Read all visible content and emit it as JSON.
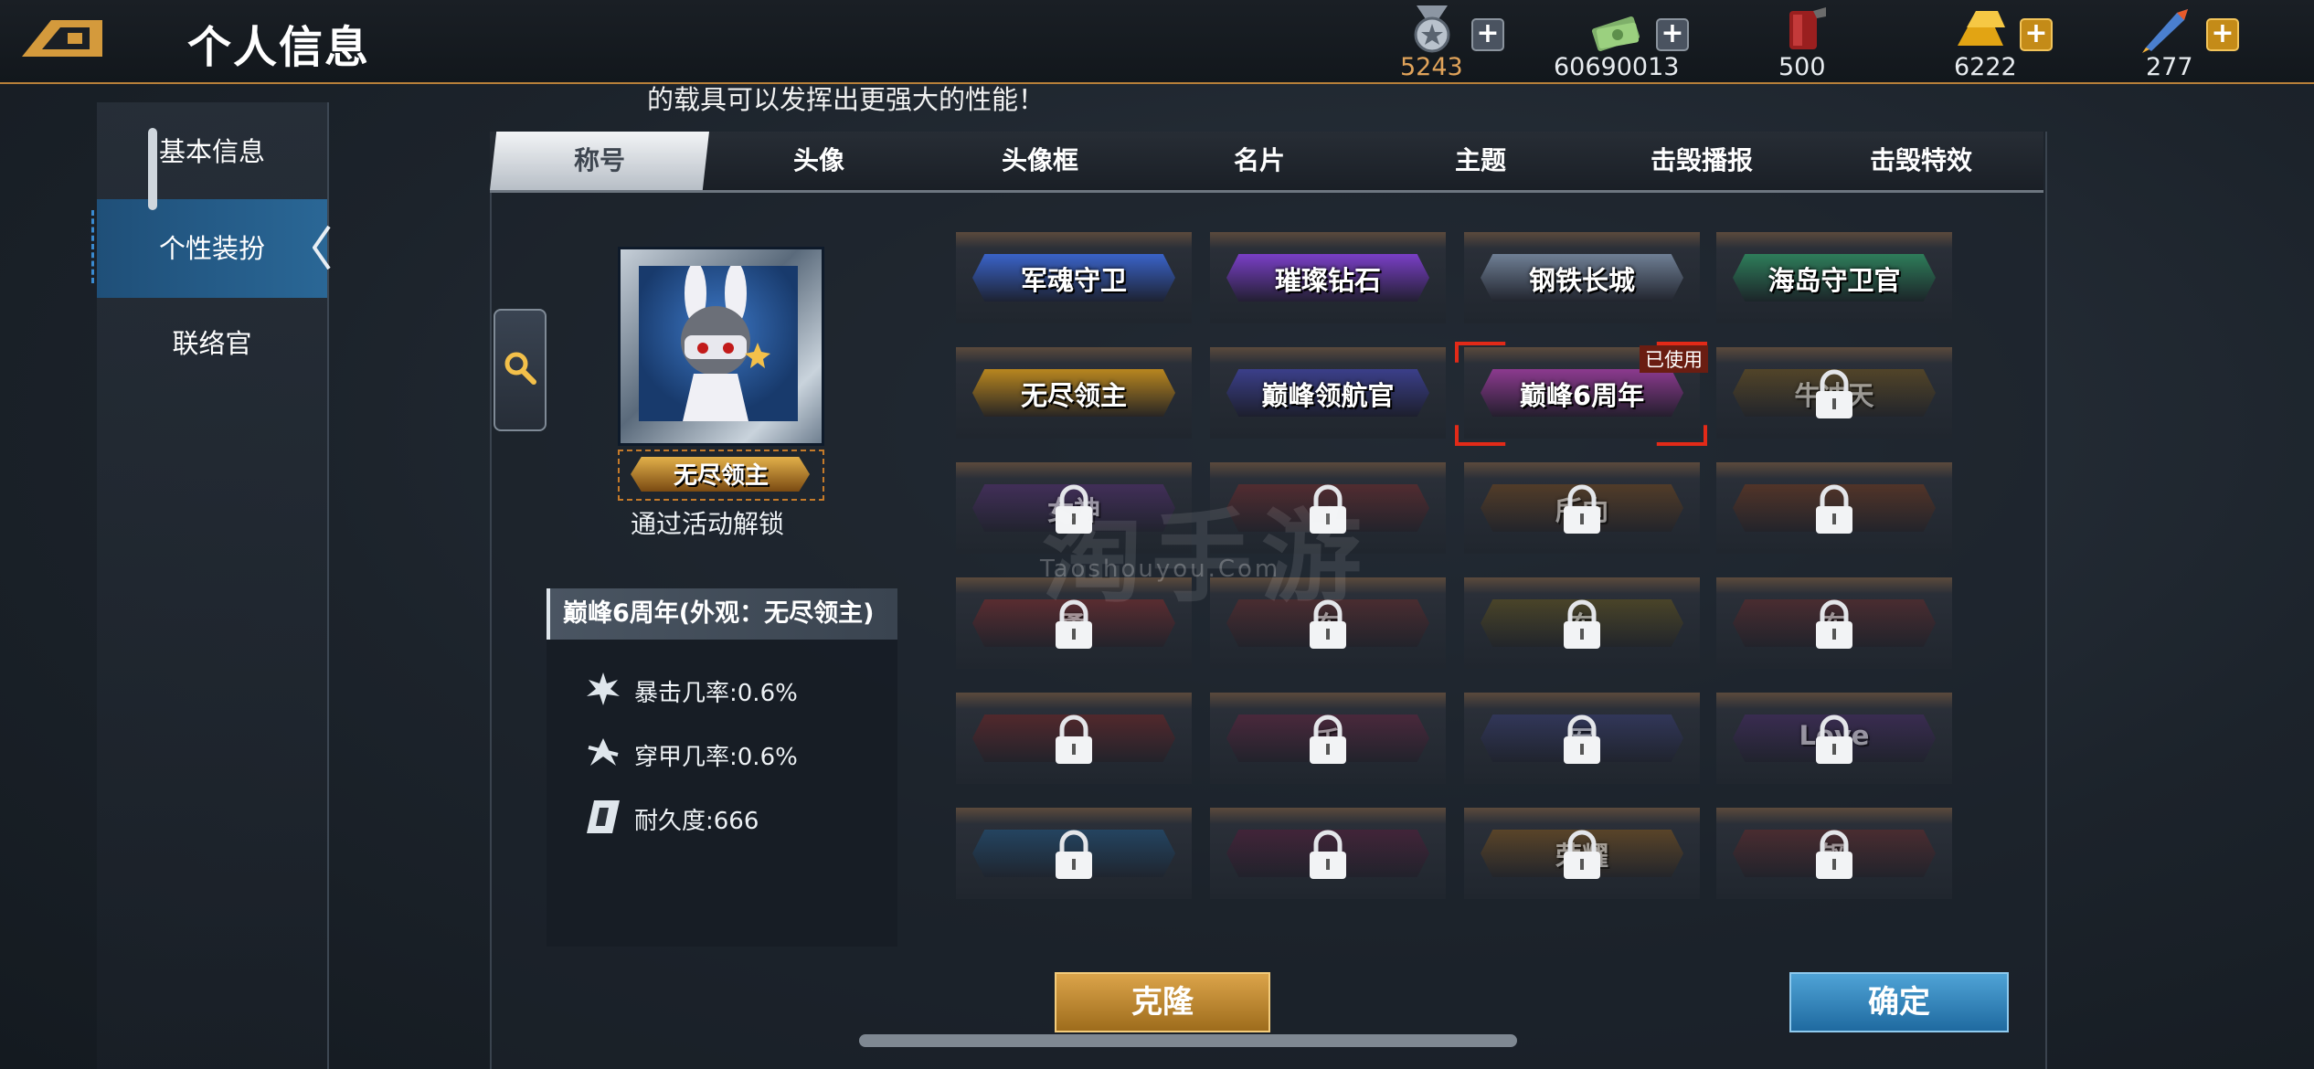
{
  "header": {
    "title": "个人信息",
    "currencies": [
      {
        "icon": "medal-icon",
        "value": "5243",
        "color": "#e0a35a",
        "has_plus": true
      },
      {
        "icon": "cash-icon",
        "value": "60690013",
        "color": "#ffffff",
        "has_plus": true
      },
      {
        "icon": "fuel-can-icon",
        "value": "500",
        "color": "#ffffff",
        "has_plus": false
      },
      {
        "icon": "gold-bar-icon",
        "value": "6222",
        "color": "#ffffff",
        "has_plus": true
      },
      {
        "icon": "rocket-icon",
        "value": "277",
        "color": "#ffffff",
        "has_plus": true
      }
    ]
  },
  "notice": "的载具可以发挥出更强大的性能！",
  "sidebar": {
    "items": [
      {
        "label": "基本信息",
        "active": false
      },
      {
        "label": "个性装扮",
        "active": true
      },
      {
        "label": "联络官",
        "active": false
      }
    ]
  },
  "tabs": [
    "称号",
    "头像",
    "头像框",
    "名片",
    "主题",
    "击毁播报",
    "击毁特效"
  ],
  "active_tab": "称号",
  "preview": {
    "badge_text": "无尽领主",
    "unlock_text": "通过活动解锁",
    "stat_title": "巅峰6周年(外观：无尽领主)",
    "stats": [
      {
        "icon": "crit-icon",
        "text": "暴击几率:0.6%"
      },
      {
        "icon": "pierce-icon",
        "text": "穿甲几率:0.6%"
      },
      {
        "icon": "durability-icon",
        "text": "耐久度:666"
      }
    ]
  },
  "grid": {
    "used_label": "已使用",
    "titles": [
      {
        "text": "军魂守卫",
        "locked": false,
        "color": "#3a63c8"
      },
      {
        "text": "璀璨钻石",
        "locked": false,
        "color": "#7a3fc6"
      },
      {
        "text": "钢铁长城",
        "locked": false,
        "color": "#6f7f95"
      },
      {
        "text": "海岛守卫官",
        "locked": false,
        "color": "#2e7d5a"
      },
      {
        "text": "无尽领主",
        "locked": false,
        "color": "#b8861f"
      },
      {
        "text": "巅峰领航官",
        "locked": false,
        "color": "#3b3f8a"
      },
      {
        "text": "巅峰6周年",
        "locked": false,
        "used": true,
        "color": "#8c3a8f"
      },
      {
        "text": "牛冲天",
        "locked": true,
        "color": "#7a5a1a"
      },
      {
        "text": "女神",
        "locked": true,
        "color": "#5a2f7a"
      },
      {
        "text": "",
        "locked": true,
        "color": "#7a2a2a"
      },
      {
        "text": "所向",
        "locked": true,
        "color": "#7a4a1a"
      },
      {
        "text": "",
        "locked": true,
        "color": "#7a3a1a"
      },
      {
        "text": "勇",
        "locked": true,
        "color": "#8a2a2a"
      },
      {
        "text": "东",
        "locked": true,
        "color": "#6a2a2a"
      },
      {
        "text": "东",
        "locked": true,
        "color": "#6a5a1a"
      },
      {
        "text": "东",
        "locked": true,
        "color": "#6a2a2a"
      },
      {
        "text": "",
        "locked": true,
        "color": "#7a2222"
      },
      {
        "text": "千",
        "locked": true,
        "color": "#6a2240"
      },
      {
        "text": "军",
        "locked": true,
        "color": "#3a3f7a"
      },
      {
        "text": "Love",
        "locked": true,
        "color": "#4a2a6a"
      },
      {
        "text": "",
        "locked": true,
        "color": "#1f5a8a"
      },
      {
        "text": "",
        "locked": true,
        "color": "#5a1a3a"
      },
      {
        "text": "荣耀",
        "locked": true,
        "color": "#8a5a1a"
      },
      {
        "text": "钢",
        "locked": true,
        "color": "#6a2a2a"
      }
    ]
  },
  "watermark": {
    "main": "淘手游",
    "sub": "Taoshouyou.Com"
  },
  "buttons": {
    "clone": "克隆",
    "confirm": "确定"
  }
}
